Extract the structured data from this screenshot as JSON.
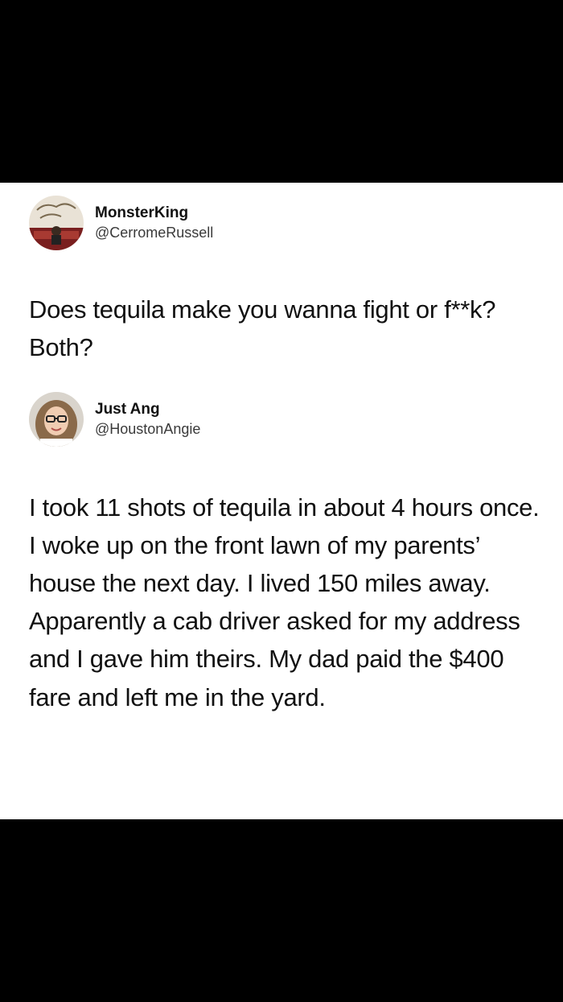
{
  "tweets": [
    {
      "display_name": "MonsterKing",
      "handle": "@CerromeRussell",
      "avatar": "monster-king-avatar",
      "text": "Does tequila make you wanna fight or f**k? Both?"
    },
    {
      "display_name": "Just Ang",
      "handle": "@HoustonAngie",
      "avatar": "just-ang-avatar",
      "text": "I took 11 shots of tequila in about 4 hours once. I woke up on the front lawn of my parents’ house the next day. I lived 150 miles away. Apparently a cab driver asked for my address and I gave him theirs. My dad paid the $400 fare and left me in the yard."
    }
  ],
  "colors": {
    "background": "#000000",
    "card": "#ffffff",
    "text": "#111111",
    "handle": "#3a3a3a"
  }
}
